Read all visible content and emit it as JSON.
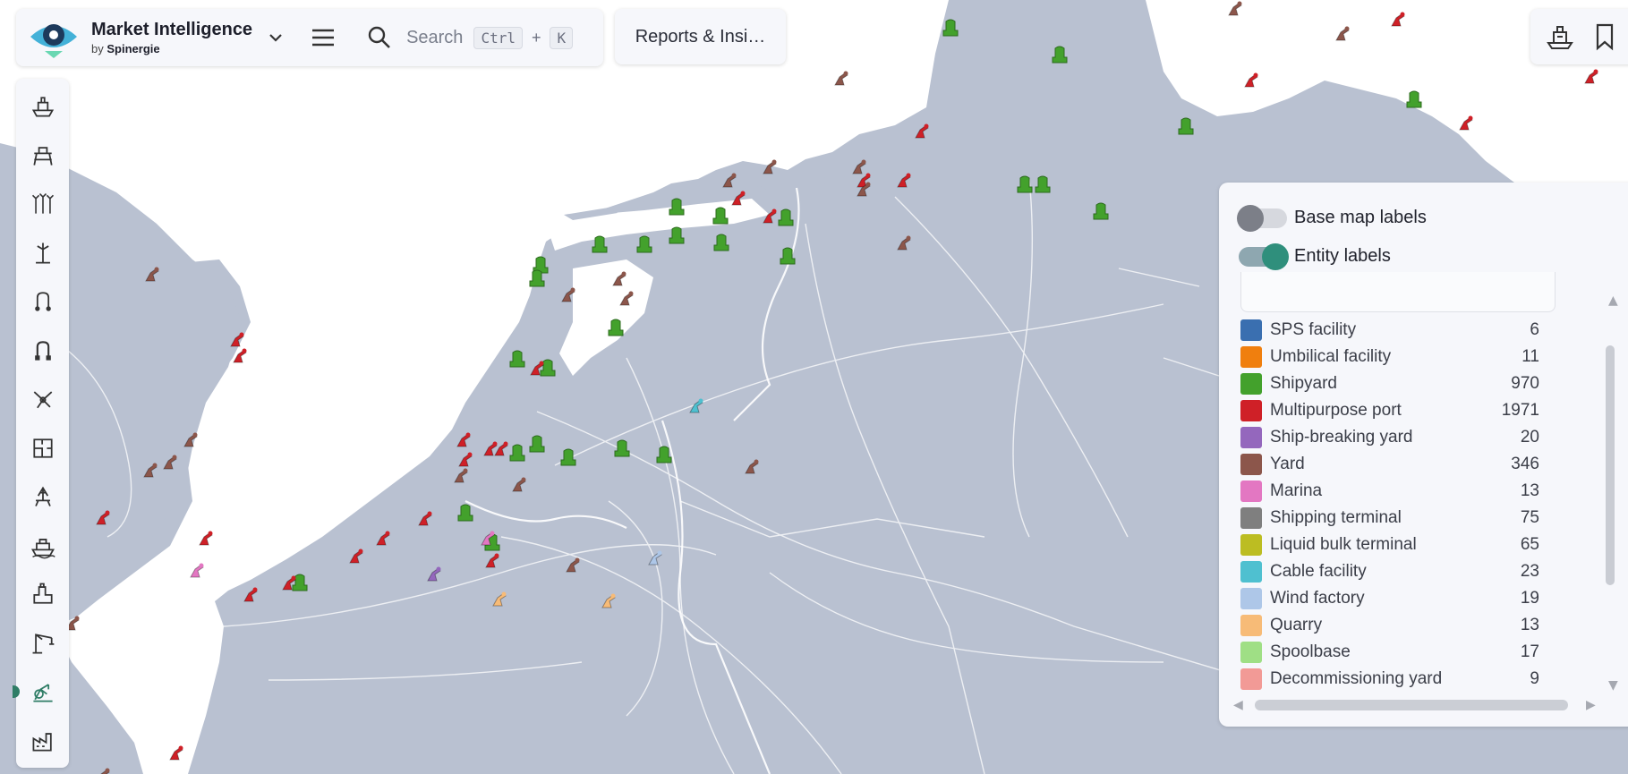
{
  "app": {
    "title": "Market Intelligence",
    "by_prefix": "by",
    "by_brand": "Spinergie"
  },
  "search": {
    "placeholder": "Search",
    "key1": "Ctrl",
    "plus": "+",
    "key2": "K"
  },
  "reports_button": "Reports & Insi…",
  "sidebar_icons": [
    "vessel-icon",
    "offshore-rig-icon",
    "wind-farm-icon",
    "wind-turbine-icon",
    "cable-icon",
    "pipeline-icon",
    "network-icon",
    "floorplan-icon",
    "oil-platform-icon",
    "ship-icon",
    "pump-icon",
    "crane-icon",
    "yard-crane-icon",
    "factory-icon"
  ],
  "sidebar_active_index": 12,
  "legend": {
    "toggles": [
      {
        "label": "Base map labels",
        "on": false
      },
      {
        "label": "Entity labels",
        "on": true
      }
    ],
    "items": [
      {
        "name": "SPS facility",
        "count": "6",
        "color": "#3a6fb0"
      },
      {
        "name": "Umbilical facility",
        "count": "11",
        "color": "#f07f0e"
      },
      {
        "name": "Shipyard",
        "count": "970",
        "color": "#43a12c"
      },
      {
        "name": "Multipurpose port",
        "count": "1971",
        "color": "#cf2027"
      },
      {
        "name": "Ship-breaking yard",
        "count": "20",
        "color": "#9467bd"
      },
      {
        "name": "Yard",
        "count": "346",
        "color": "#8c564b"
      },
      {
        "name": "Marina",
        "count": "13",
        "color": "#e377c2"
      },
      {
        "name": "Shipping terminal",
        "count": "75",
        "color": "#7f7f7f"
      },
      {
        "name": "Liquid bulk terminal",
        "count": "65",
        "color": "#bcbd22"
      },
      {
        "name": "Cable facility",
        "count": "23",
        "color": "#4fc0d0"
      },
      {
        "name": "Wind factory",
        "count": "19",
        "color": "#aec7e8"
      },
      {
        "name": "Quarry",
        "count": "13",
        "color": "#f7bb77"
      },
      {
        "name": "Spoolbase",
        "count": "17",
        "color": "#9fdf85"
      },
      {
        "name": "Decommissioning yard",
        "count": "9",
        "color": "#f29a96"
      }
    ]
  },
  "colors": {
    "land": "#b9c1d1",
    "sea": "#ffffff",
    "accent": "#2f8f7c"
  },
  "map_markers": [
    {
      "type": "shipyard",
      "color": "#43a12c"
    },
    {
      "type": "multipurpose-port",
      "color": "#cf2027"
    },
    {
      "type": "yard",
      "color": "#8c564b"
    },
    {
      "type": "ship-breaking-yard",
      "color": "#9467bd"
    },
    {
      "type": "marina",
      "color": "#e377c2"
    },
    {
      "type": "cable-facility",
      "color": "#4fc0d0"
    },
    {
      "type": "wind-factory",
      "color": "#aec7e8"
    },
    {
      "type": "quarry",
      "color": "#f7bb77"
    }
  ]
}
